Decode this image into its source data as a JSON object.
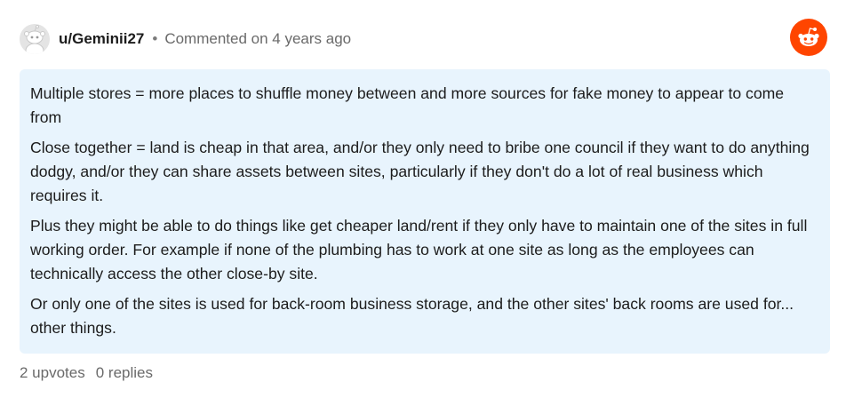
{
  "comment": {
    "username": "u/Geminii27",
    "separator": "•",
    "meta": "Commented on 4 years ago",
    "paragraphs": [
      "Multiple stores = more places to shuffle money between and more sources for fake money to appear to come from",
      "Close together = land is cheap in that area, and/or they only need to bribe one council if they want to do anything dodgy, and/or they can share assets between sites, particularly if they don't do a lot of real business which requires it.",
      "Plus they might be able to do things like get cheaper land/rent if they only have to maintain one of the sites in full working order. For example if none of the plumbing has to work at one site as long as the employees can technically access the other close-by site.",
      "Or only one of the sites is used for back-room business storage, and the other sites' back rooms are used for... other things."
    ],
    "upvotes": "2 upvotes",
    "replies": "0 replies"
  },
  "icons": {
    "avatar": "snoo-avatar-icon",
    "brand": "reddit-logo-icon"
  },
  "colors": {
    "brand": "#ff4500",
    "comment_bg": "#e8f4fd",
    "meta_text": "#6a6a6a"
  }
}
